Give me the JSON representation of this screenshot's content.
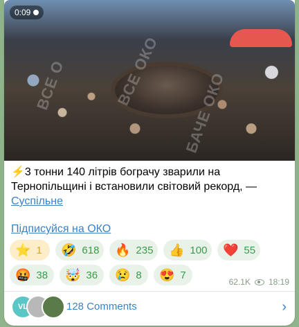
{
  "media": {
    "duration": "0:09",
    "watermarks": [
      "ВСЕ О",
      "ВСЕ ОКО",
      "БАЧЕ ОКО"
    ]
  },
  "post": {
    "bolt": "⚡",
    "text": "3 тонни 140 літрів бограчу зварили на Тернопільщині і встановили світовий рекорд, —",
    "source_link": "Суспільне",
    "subscribe_link": "Підписуйся на ОКО"
  },
  "reactions": [
    {
      "emoji": "⭐",
      "count": "1"
    },
    {
      "emoji": "🤣",
      "count": "618"
    },
    {
      "emoji": "🔥",
      "count": "235"
    },
    {
      "emoji": "👍",
      "count": "100"
    },
    {
      "emoji": "❤️",
      "count": "55"
    },
    {
      "emoji": "🤬",
      "count": "38"
    },
    {
      "emoji": "🤯",
      "count": "36"
    },
    {
      "emoji": "😢",
      "count": "8"
    },
    {
      "emoji": "😍",
      "count": "7"
    }
  ],
  "meta": {
    "views": "62.1K",
    "time": "18:19"
  },
  "comments": {
    "avatar_initials": "VL",
    "label": "128 Comments",
    "chevron": "›"
  }
}
